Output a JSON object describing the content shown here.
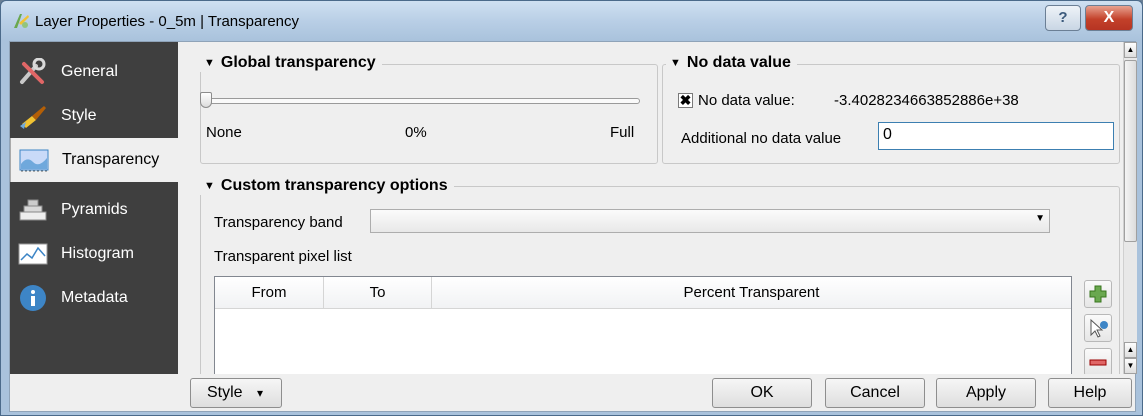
{
  "window": {
    "title": "Layer Properties - 0_5m | Transparency",
    "help_glyph": "?",
    "close_glyph": "X"
  },
  "sidebar": {
    "items": [
      {
        "label": "General",
        "icon": "tools-icon"
      },
      {
        "label": "Style",
        "icon": "paintbrush-icon"
      },
      {
        "label": "Transparency",
        "icon": "transparency-icon"
      },
      {
        "label": "Pyramids",
        "icon": "pyramids-icon"
      },
      {
        "label": "Histogram",
        "icon": "histogram-icon"
      },
      {
        "label": "Metadata",
        "icon": "info-icon"
      }
    ],
    "active": "Transparency"
  },
  "global_transparency": {
    "title": "Global transparency",
    "min_label": "None",
    "value_label": "0%",
    "max_label": "Full",
    "value": 0
  },
  "no_data": {
    "title": "No data value",
    "checkbox_label": "No data value:",
    "checked": true,
    "check_glyph": "✖",
    "value": "-3.4028234663852886e+38",
    "additional_label": "Additional no data value",
    "additional_value": "0"
  },
  "custom": {
    "title": "Custom transparency options",
    "band_label": "Transparency band",
    "band_value": "",
    "pixel_list_label": "Transparent pixel list",
    "columns": [
      "From",
      "To",
      "Percent Transparent"
    ]
  },
  "bottom": {
    "style_label": "Style",
    "style_arrow": "▾",
    "ok_label": "OK",
    "cancel_label": "Cancel",
    "apply_label": "Apply",
    "help_label": "Help"
  },
  "colors": {
    "sidebar_bg": "#3f3f3f",
    "panel_bg": "#efefef",
    "close_red": "#c3412a",
    "input_focus_border": "#3c7fb1"
  }
}
